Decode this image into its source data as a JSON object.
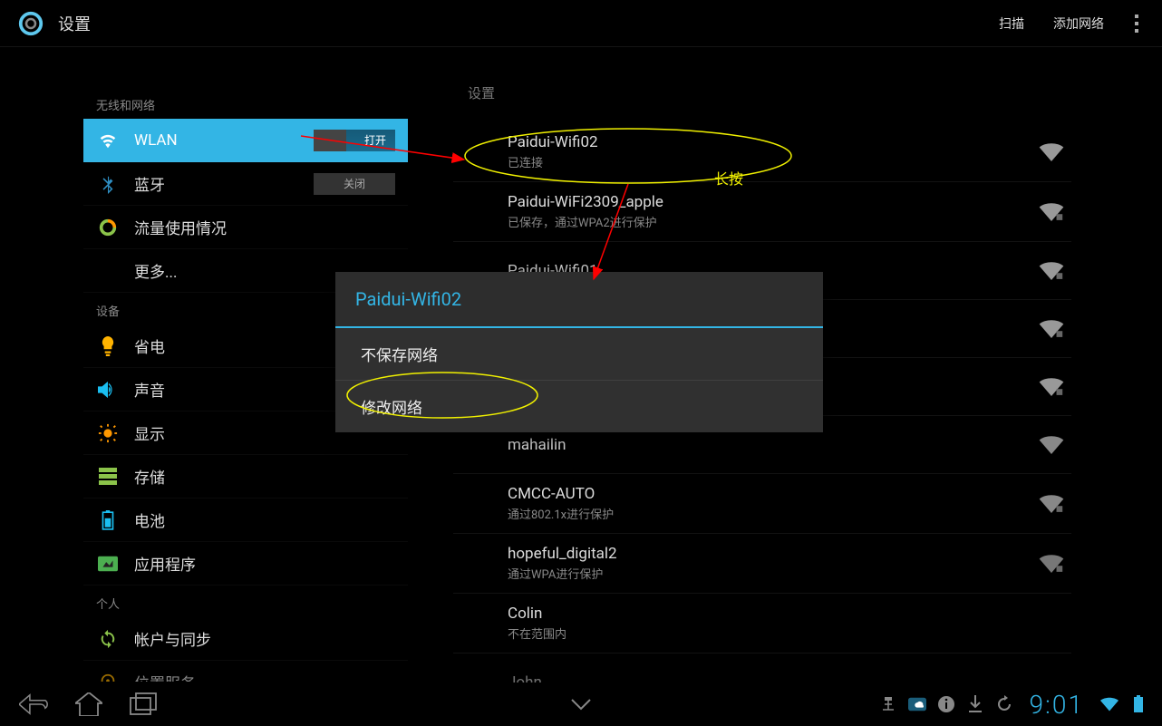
{
  "header": {
    "title": "设置",
    "scan": "扫描",
    "add_network": "添加网络"
  },
  "sidebar": {
    "section_wireless": "无线和网络",
    "section_device": "设备",
    "section_personal": "个人",
    "items": {
      "wlan": "WLAN",
      "wlan_switch": "打开",
      "bluetooth": "蓝牙",
      "bluetooth_switch": "关闭",
      "data_usage": "流量使用情况",
      "more": "更多...",
      "power_save": "省电",
      "sound": "声音",
      "display": "显示",
      "storage": "存储",
      "battery": "电池",
      "apps": "应用程序",
      "accounts_sync": "帐户与同步",
      "location": "位置服务"
    }
  },
  "content": {
    "header": "设置",
    "networks": [
      {
        "ssid": "Paidui-Wifi02",
        "status": "已连接"
      },
      {
        "ssid": "Paidui-WiFi2309_apple",
        "status": "已保存，通过WPA2进行保护"
      },
      {
        "ssid": "Paidui-Wifi01",
        "status": ""
      },
      {
        "ssid": "",
        "status": ""
      },
      {
        "ssid": "",
        "status": ""
      },
      {
        "ssid": "mahailin",
        "status": ""
      },
      {
        "ssid": "CMCC-AUTO",
        "status": "通过802.1x进行保护"
      },
      {
        "ssid": "hopeful_digital2",
        "status": "通过WPA进行保护"
      },
      {
        "ssid": "Colin",
        "status": "不在范围内"
      },
      {
        "ssid": "John",
        "status": ""
      }
    ]
  },
  "modal": {
    "title": "Paidui-Wifi02",
    "forget": "不保存网络",
    "modify": "修改网络"
  },
  "annotations": {
    "long_press": "长按"
  },
  "navbar": {
    "time": "9:01"
  }
}
